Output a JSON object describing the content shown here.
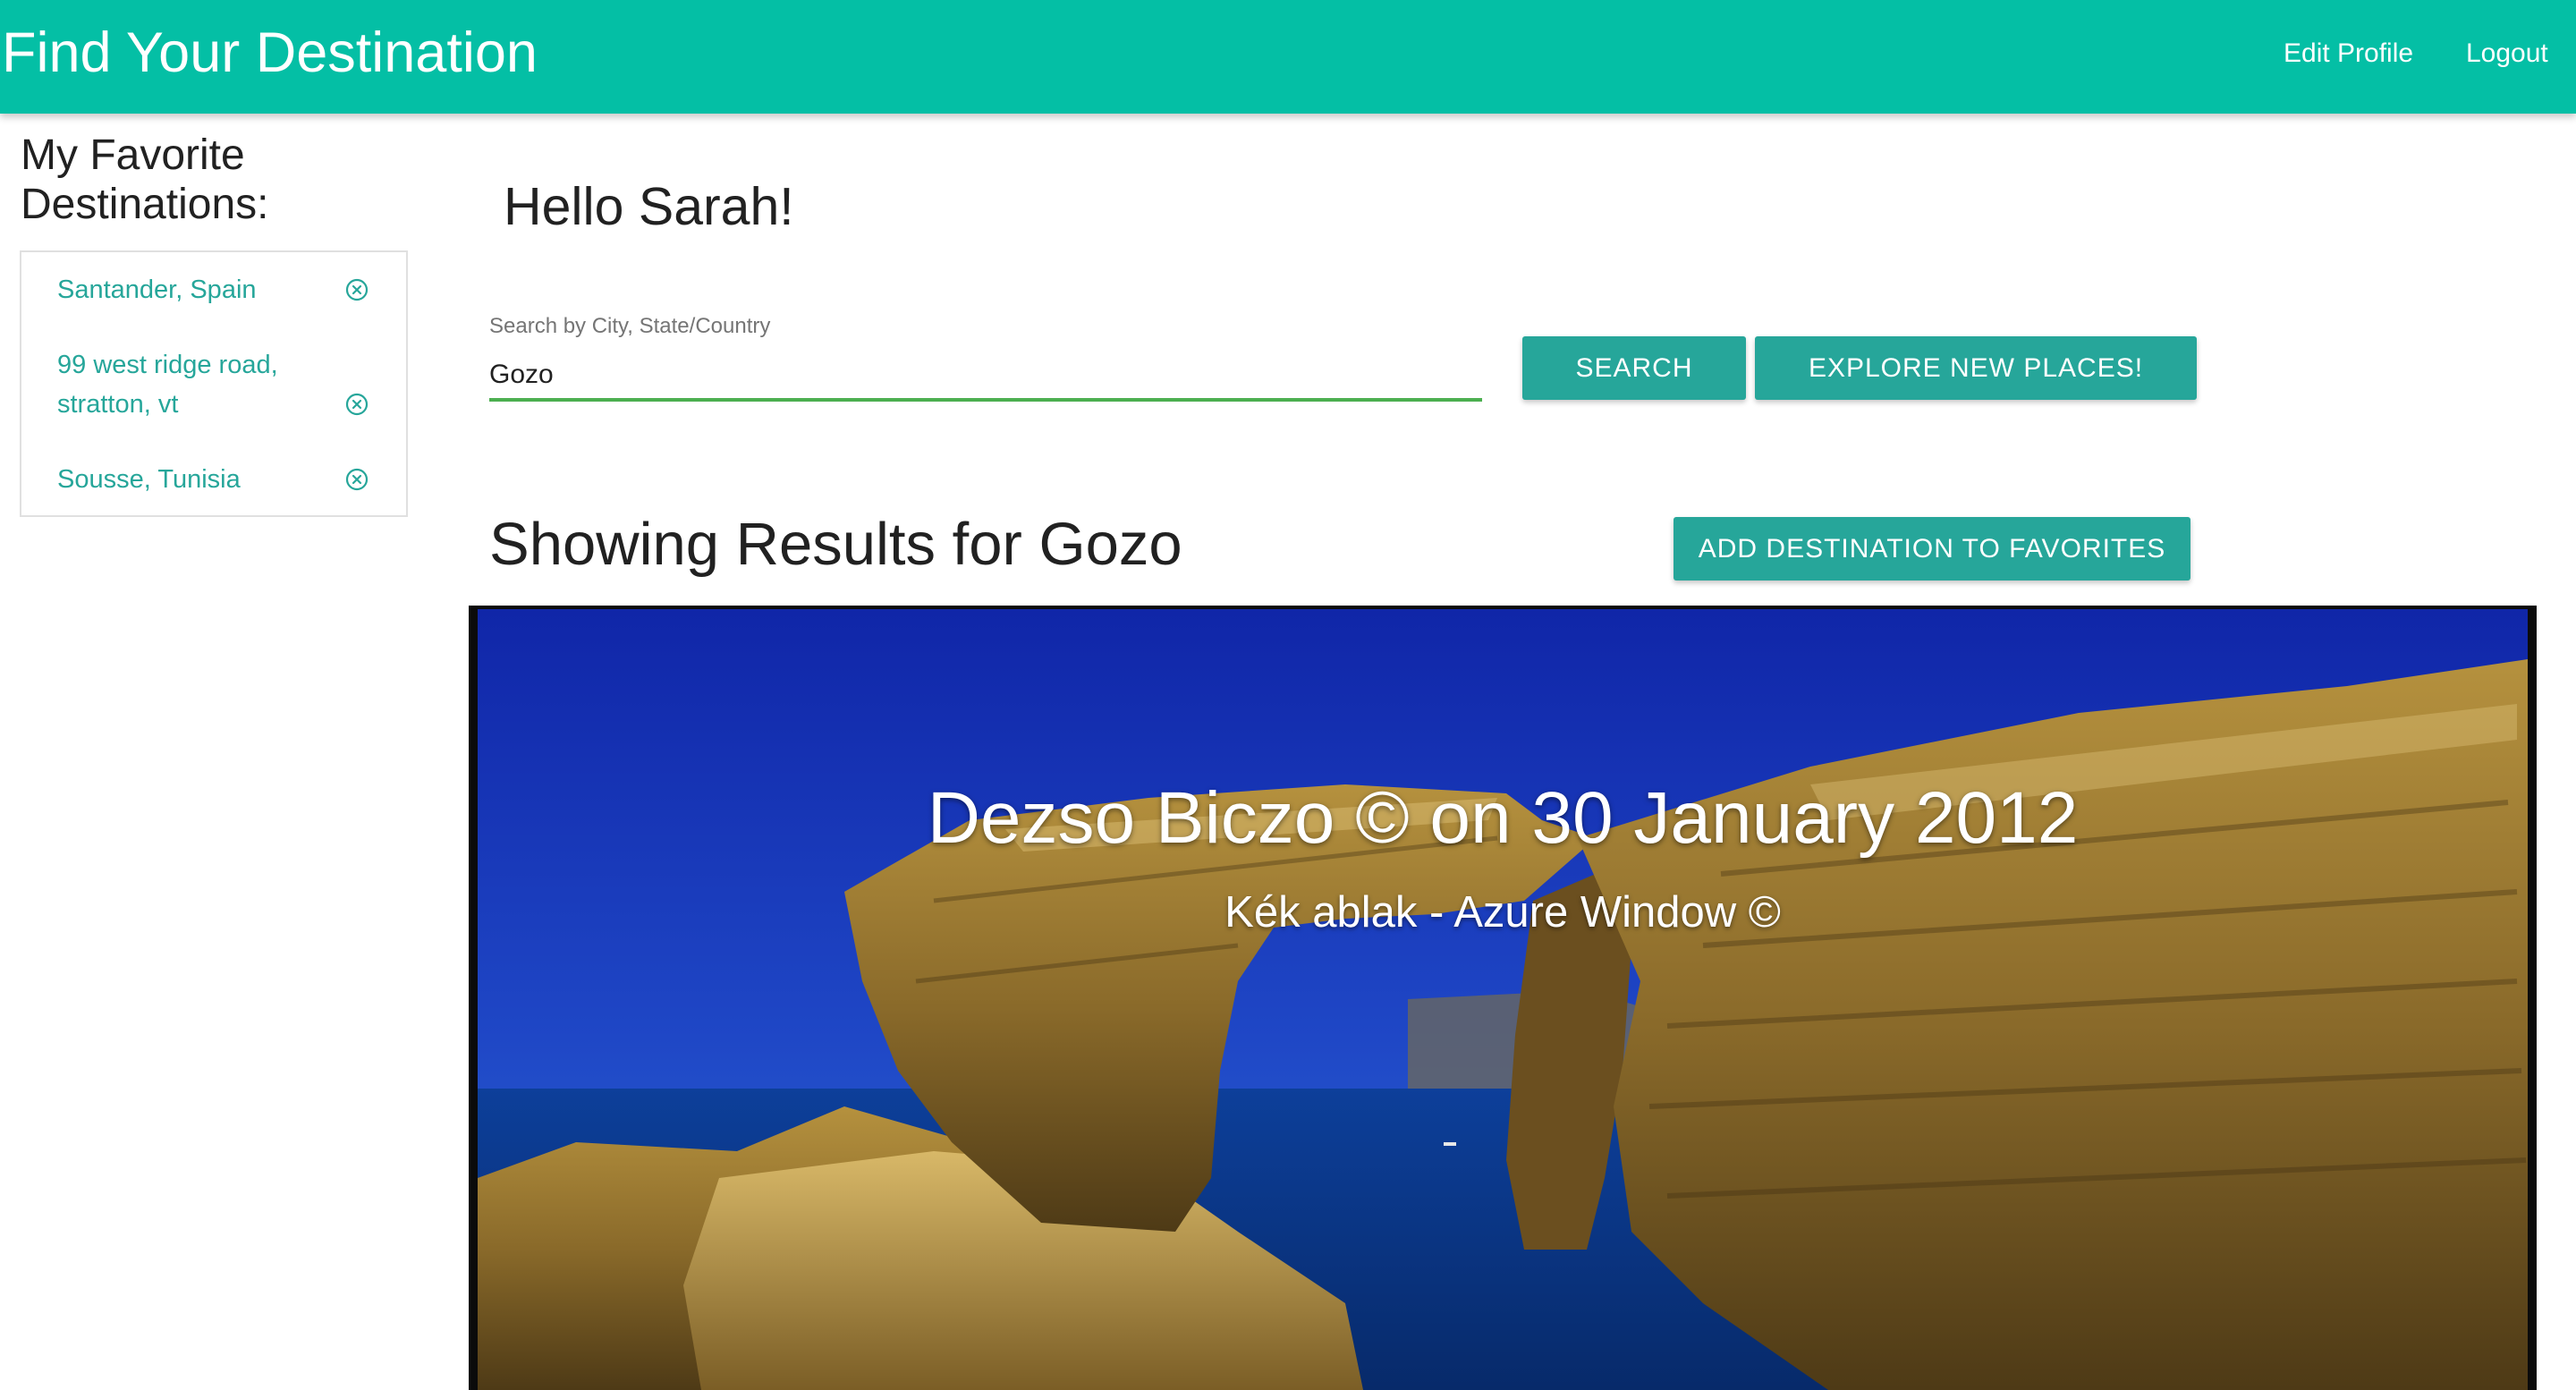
{
  "app": {
    "title": "Find Your Destination",
    "nav": {
      "edit_profile": "Edit Profile",
      "logout": "Logout"
    }
  },
  "sidebar": {
    "title": "My Favorite Destinations:",
    "favorites": [
      {
        "label": "Santander, Spain",
        "remove_icon": "circle-x-icon"
      },
      {
        "label": "99 west ridge road, stratton, vt",
        "remove_icon": "circle-x-icon"
      },
      {
        "label": "Sousse, Tunisia",
        "remove_icon": "circle-x-icon"
      }
    ]
  },
  "main": {
    "greeting": "Hello Sarah!",
    "search": {
      "label": "Search by City, State/Country",
      "value": "Gozo"
    },
    "buttons": {
      "search": "SEARCH",
      "explore": "EXPLORE NEW PLACES!",
      "add_favorite": "ADD DESTINATION TO FAVORITES"
    },
    "results_title": "Showing Results for Gozo",
    "photo": {
      "caption": "Dezso Biczo © on 30 January 2012",
      "subcaption": "Kék ablak - Azure Window ©"
    }
  },
  "colors": {
    "navbar": "#04bfa5",
    "button": "#26a69a",
    "link": "#26a69a",
    "input_underline": "#4caf50"
  }
}
